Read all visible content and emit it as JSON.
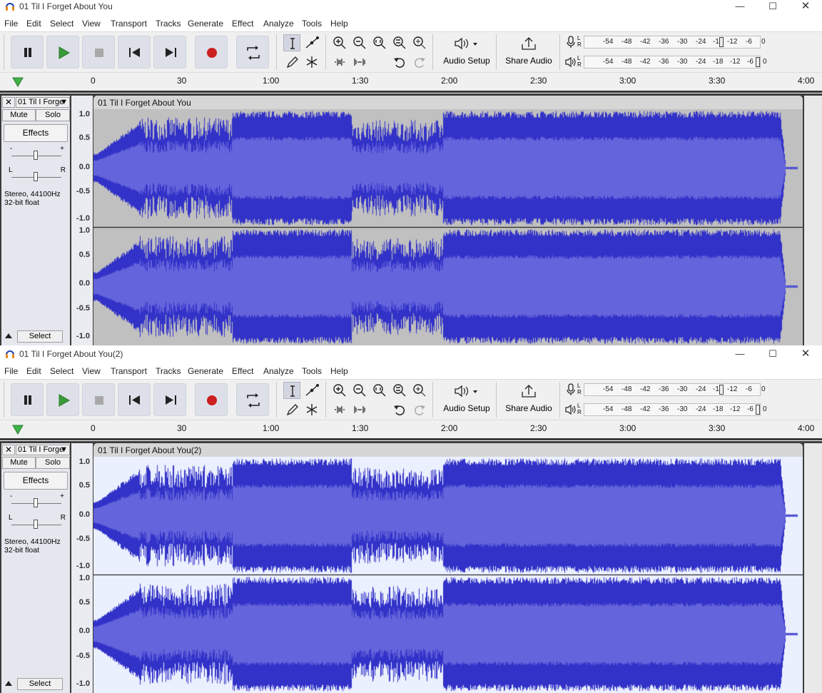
{
  "windows": [
    {
      "title": "01 Til I Forget About You",
      "track_name_short": "01 Til I Forge",
      "clip_name": "01 Til I Forget About You",
      "selected": true
    },
    {
      "title": "01 Til I Forget About You(2)",
      "track_name_short": "01 Til I Forge",
      "clip_name": "01 Til I Forget About You(2)",
      "selected": false
    }
  ],
  "window_controls": {
    "minimize": "—",
    "maximize": "☐",
    "close": "✕"
  },
  "menu": [
    "File",
    "Edit",
    "Select",
    "View",
    "Transport",
    "Tracks",
    "Generate",
    "Effect",
    "Analyze",
    "Tools",
    "Help"
  ],
  "toolbar": {
    "audio_setup_label": "Audio Setup",
    "share_audio_label": "Share Audio",
    "meter_ticks": [
      "-54",
      "-48",
      "-42",
      "-36",
      "-30",
      "-24",
      "-1",
      "-12",
      "-6",
      "0"
    ],
    "playback_meter_ticks": [
      "-54",
      "-48",
      "-42",
      "-36",
      "-30",
      "-24",
      "-18",
      "-12",
      "-6",
      "0"
    ],
    "meter_lr": "L\nR"
  },
  "timeline": {
    "labels": [
      "0",
      "30",
      "1:00",
      "1:30",
      "2:00",
      "2:30",
      "3:00",
      "3:30",
      "4:00"
    ]
  },
  "track_panel": {
    "close": "✕",
    "mute_label": "Mute",
    "solo_label": "Solo",
    "effects_label": "Effects",
    "gain_minus": "-",
    "gain_plus": "+",
    "pan_left": "L",
    "pan_right": "R",
    "format_line1": "Stereo, 44100Hz",
    "format_line2": "32-bit float",
    "select_label": "Select"
  },
  "amplitude_labels": [
    "1.0",
    "0.5",
    "0.0",
    "-0.5",
    "-1.0"
  ],
  "colors": {
    "wave_dark": "#3232c8",
    "wave_light": "#6464dc",
    "bg_selected": "#c0c0c0",
    "bg_unselected": "#ebf0ff",
    "record": "#cc2020",
    "play": "#3a9a3a"
  }
}
